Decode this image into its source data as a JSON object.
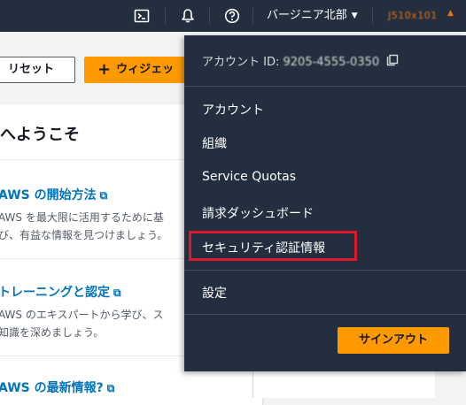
{
  "topbar": {
    "region_label": "バージニア北部",
    "account_label": "J510x101"
  },
  "page": {
    "reset_button": "リセット",
    "add_widget_button": "ウィジェッ",
    "welcome_title": "へようこそ",
    "sections": [
      {
        "link": "AWS の開始方法",
        "lines": [
          "AWS を最大限に活用するために基",
          "び、有益な情報を見つけましょう。"
        ]
      },
      {
        "link": "トレーニングと認定",
        "lines": [
          "AWS のエキスパートから学び、ス",
          "知識を深めましょう。"
        ]
      },
      {
        "link": "AWS の最新情報?",
        "lines": []
      }
    ]
  },
  "dropdown": {
    "account_id_label": "アカウント ID:",
    "account_id_value": "9205-4555-0350",
    "items": [
      "アカウント",
      "組織",
      "Service Quotas",
      "請求ダッシュボード",
      "セキュリティ認証情報",
      "設定"
    ],
    "signout_button": "サインアウト"
  },
  "colors": {
    "topbar_bg": "#232f3e",
    "accent_orange": "#ff9900",
    "link_blue": "#0073bb",
    "highlight_red": "#e0192a"
  },
  "icons": [
    "cloudshell-icon",
    "notifications-bell-icon",
    "help-icon",
    "caret-down-icon",
    "copy-icon",
    "external-link-icon",
    "plus-icon"
  ]
}
